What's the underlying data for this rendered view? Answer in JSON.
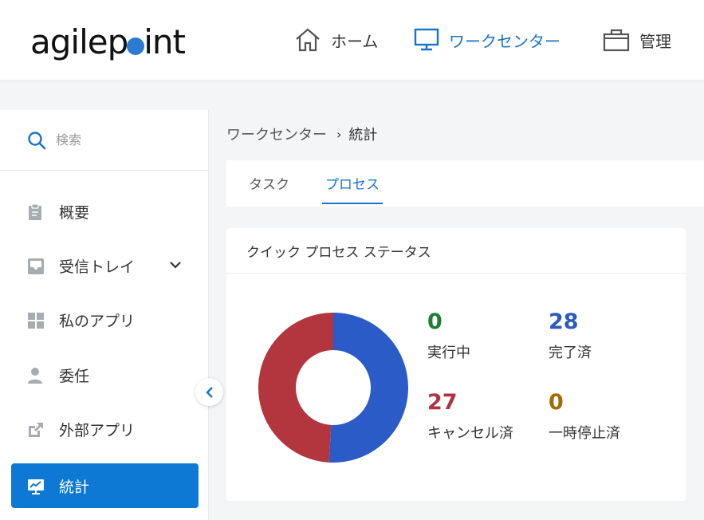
{
  "header": {
    "logo_pre": "agilep",
    "logo_post": "int",
    "nav": [
      {
        "label": "ホーム",
        "icon": "home-icon"
      },
      {
        "label": "ワークセンター",
        "icon": "monitor-icon"
      },
      {
        "label": "管理",
        "icon": "briefcase-icon"
      }
    ]
  },
  "sidebar": {
    "search_placeholder": "検索",
    "items": [
      {
        "label": "概要",
        "icon": "clipboard-icon"
      },
      {
        "label": "受信トレイ",
        "icon": "inbox-icon"
      },
      {
        "label": "私のアプリ",
        "icon": "apps-grid-icon"
      },
      {
        "label": "委任",
        "icon": "user-icon"
      },
      {
        "label": "外部アプリ",
        "icon": "external-link-icon"
      },
      {
        "label": "統計",
        "icon": "chart-monitor-icon"
      }
    ]
  },
  "breadcrumb": {
    "parent": "ワークセンター",
    "current": "統計"
  },
  "tabs": [
    {
      "label": "タスク"
    },
    {
      "label": "プロセス"
    }
  ],
  "card": {
    "title": "クイック プロセス ステータス",
    "stats": {
      "running": {
        "value": "0",
        "label": "実行中",
        "color": "#1e7e34"
      },
      "complete": {
        "value": "28",
        "label": "完了済",
        "color": "#2a5bbf"
      },
      "cancelled": {
        "value": "27",
        "label": "キャンセル済",
        "color": "#b13341"
      },
      "paused": {
        "value": "0",
        "label": "一時停止済",
        "color": "#a6690c"
      }
    }
  },
  "colors": {
    "accent": "#0e78d5",
    "donut_complete": "#2a5bc6",
    "donut_cancelled": "#b3353e"
  }
}
